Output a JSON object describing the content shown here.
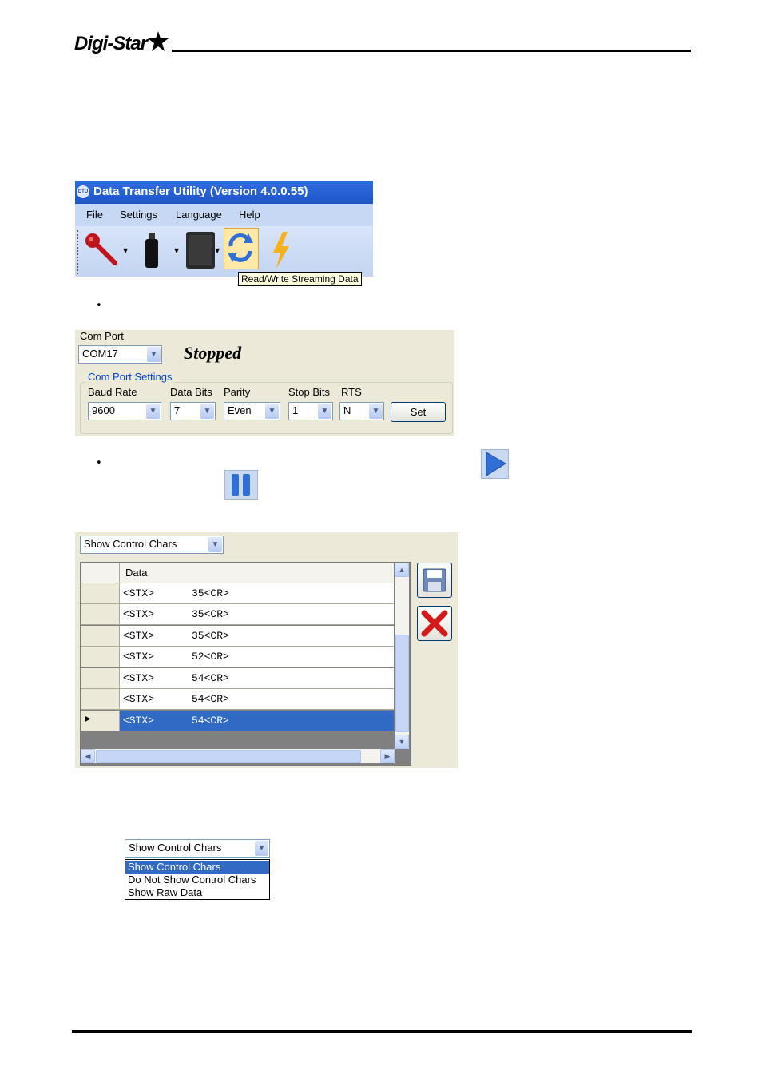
{
  "header": {
    "logo_text": "Digi-Star"
  },
  "window": {
    "title": "Data Transfer Utility (Version 4.0.0.55)",
    "app_icon_text": "DTU",
    "menu": [
      "File",
      "Settings",
      "Language",
      "Help"
    ],
    "toolbar": {
      "icons": [
        "key-icon",
        "flash-drive-icon",
        "indicator-device-icon",
        "refresh-arrows-icon",
        "lightning-icon"
      ],
      "tooltip": "Read/Write Streaming Data"
    }
  },
  "bullets": [
    "•",
    "•"
  ],
  "com_port": {
    "label": "Com Port",
    "value": "COM17",
    "status": "Stopped",
    "group_label": "Com Port Settings",
    "fields": [
      {
        "label": "Baud Rate",
        "value": "9600"
      },
      {
        "label": "Data Bits",
        "value": "7"
      },
      {
        "label": "Parity",
        "value": "Even"
      },
      {
        "label": "Stop Bits",
        "value": "1"
      },
      {
        "label": "RTS",
        "value": "N"
      }
    ],
    "set_label": "Set"
  },
  "controls": {
    "play_icon": "play-icon",
    "pause_icon": "pause-icon"
  },
  "data_view": {
    "mode_value": "Show Control Chars",
    "column_header": "Data",
    "rows": [
      {
        "a": "<STX>",
        "b": "35<CR>"
      },
      {
        "a": "<STX>",
        "b": "35<CR>"
      },
      {
        "a": "<STX>",
        "b": "35<CR>"
      },
      {
        "a": "<STX>",
        "b": "52<CR>"
      },
      {
        "a": "<STX>",
        "b": "54<CR>"
      },
      {
        "a": "<STX>",
        "b": "54<CR>"
      },
      {
        "a": "<STX>",
        "b": "54<CR>"
      }
    ],
    "selected_row_marker": "▶",
    "save_icon": "floppy-disk-icon",
    "clear_icon": "red-x-icon"
  },
  "dropdown": {
    "value": "Show Control Chars",
    "options": [
      "Show Control Chars",
      "Do Not Show Control Chars",
      "Show Raw Data"
    ],
    "highlighted": "Show Control Chars"
  }
}
